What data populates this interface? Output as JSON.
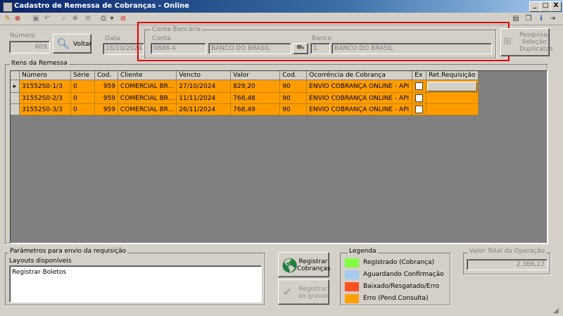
{
  "window": {
    "title": "Cadastro de Remessa de Cobranças - Online",
    "min": "_",
    "max": "□",
    "close": "X"
  },
  "header": {
    "numero_label": "Número",
    "numero_value": "609",
    "voltar_label": "Voltar",
    "data_label": "Data",
    "data_value": "16/10/2024",
    "conta_bancaria_title": "Conta Bancária",
    "conta_label": "Conta",
    "conta_value": "9888-4",
    "conta_name": "BANCO DO BRASIL",
    "banco_label": "Banco",
    "banco_value": "1",
    "banco_name": "BANCO DO BRASIL",
    "pesquisa_label_1": "Pesquisa/",
    "pesquisa_label_2": "Seleção",
    "pesquisa_label_3": "Duplicatas"
  },
  "grid": {
    "title": "Itens da Remessa",
    "columns": [
      "Número",
      "Série",
      "Cod.",
      "Cliente",
      "Vencto",
      "Valor",
      "Cod.",
      "Ocorrência de Cobrança",
      "Ex",
      "Ret.Requisição"
    ],
    "rows": [
      {
        "indicator": "▸",
        "numero": "31552S0-1/3",
        "serie": "0",
        "cod": "959",
        "cliente": "COMERCIAL BR...",
        "vencto": "27/10/2024",
        "valor": "829,20",
        "cod2": "90",
        "ocorrencia": "ENVIO COBRANÇA ONLINE - API"
      },
      {
        "indicator": "",
        "numero": "31552S0-2/3",
        "serie": "0",
        "cod": "959",
        "cliente": "COMERCIAL BR...",
        "vencto": "11/11/2024",
        "valor": "768,48",
        "cod2": "90",
        "ocorrencia": "ENVIO COBRANÇA ONLINE - API"
      },
      {
        "indicator": "",
        "numero": "31552S0-3/3",
        "serie": "0",
        "cod": "959",
        "cliente": "COMERCIAL BR...",
        "vencto": "26/11/2024",
        "valor": "768,49",
        "cod2": "90",
        "ocorrencia": "ENVIO COBRANÇA ONLINE - API"
      }
    ],
    "row_color": "#ff9d00"
  },
  "params": {
    "title": "Parâmetros para envio da requisição",
    "layouts_label": "Layouts disponíveis",
    "layouts": [
      "Registrar Boletos"
    ]
  },
  "actions": {
    "registrar_1": "Registrar",
    "registrar_2": "Cobranças",
    "gravar_1": "Registrar",
    "gravar_2": "ao gravar"
  },
  "legend": {
    "title": "Legenda",
    "items": [
      {
        "label": "Registrado (Cobrança)",
        "color": "#80ff40"
      },
      {
        "label": "Aguardando Confirmação",
        "color": "#a6caf0"
      },
      {
        "label": "Baixado/Resgatado/Erro",
        "color": "#ff5020"
      },
      {
        "label": "Erro (Pend.Consulta)",
        "color": "#ffa000"
      }
    ]
  },
  "total": {
    "label": "Valor Total da Operação",
    "value": "2.366,17"
  }
}
